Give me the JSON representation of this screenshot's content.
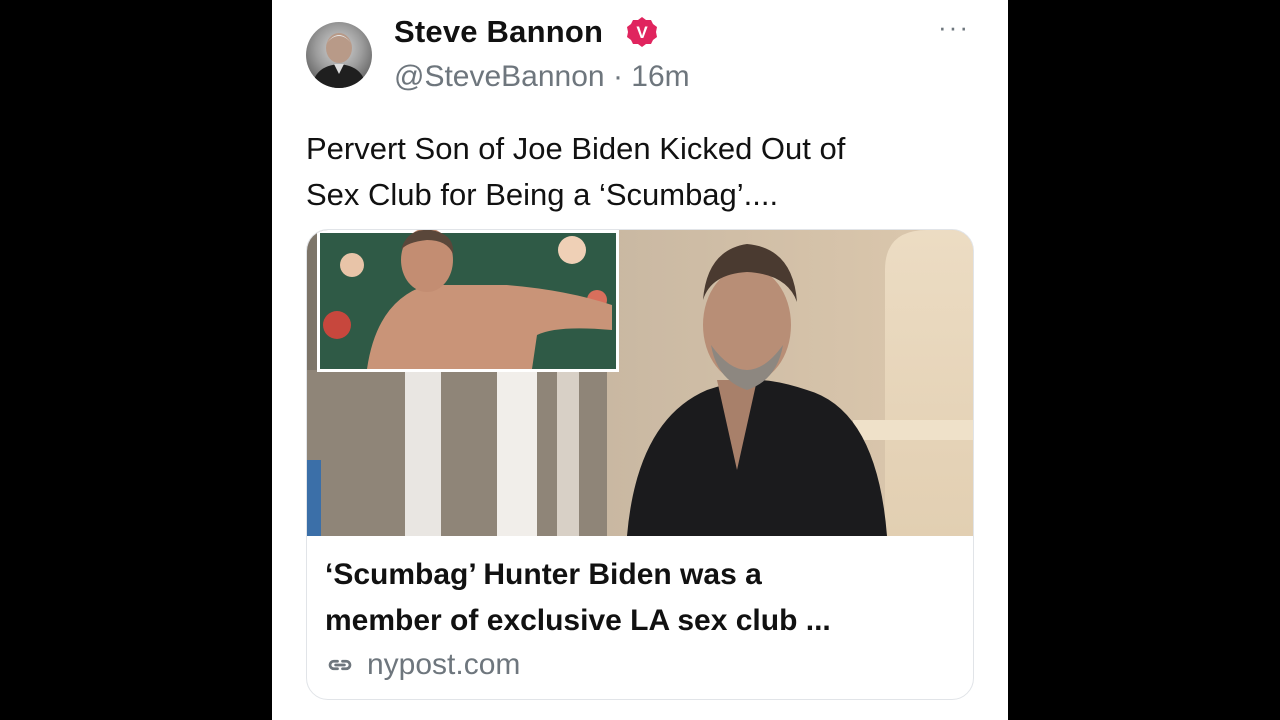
{
  "post": {
    "author": {
      "display_name": "Steve Bannon",
      "handle": "@SteveBannon",
      "verified_badge": "V",
      "verified_color": "#e0245e",
      "avatar_icon": "avatar-portrait"
    },
    "separator": "·",
    "timestamp": "16m",
    "more_label": "···",
    "text_lines": [
      "Pervert Son of Joe Biden Kicked Out of",
      "Sex Club for Being a ‘Scumbag’...."
    ],
    "link_card": {
      "title_lines": [
        "‘Scumbag’ Hunter Biden was a",
        "member of exclusive LA sex club ..."
      ],
      "domain": "nypost.com",
      "domain_icon": "link-icon"
    }
  }
}
